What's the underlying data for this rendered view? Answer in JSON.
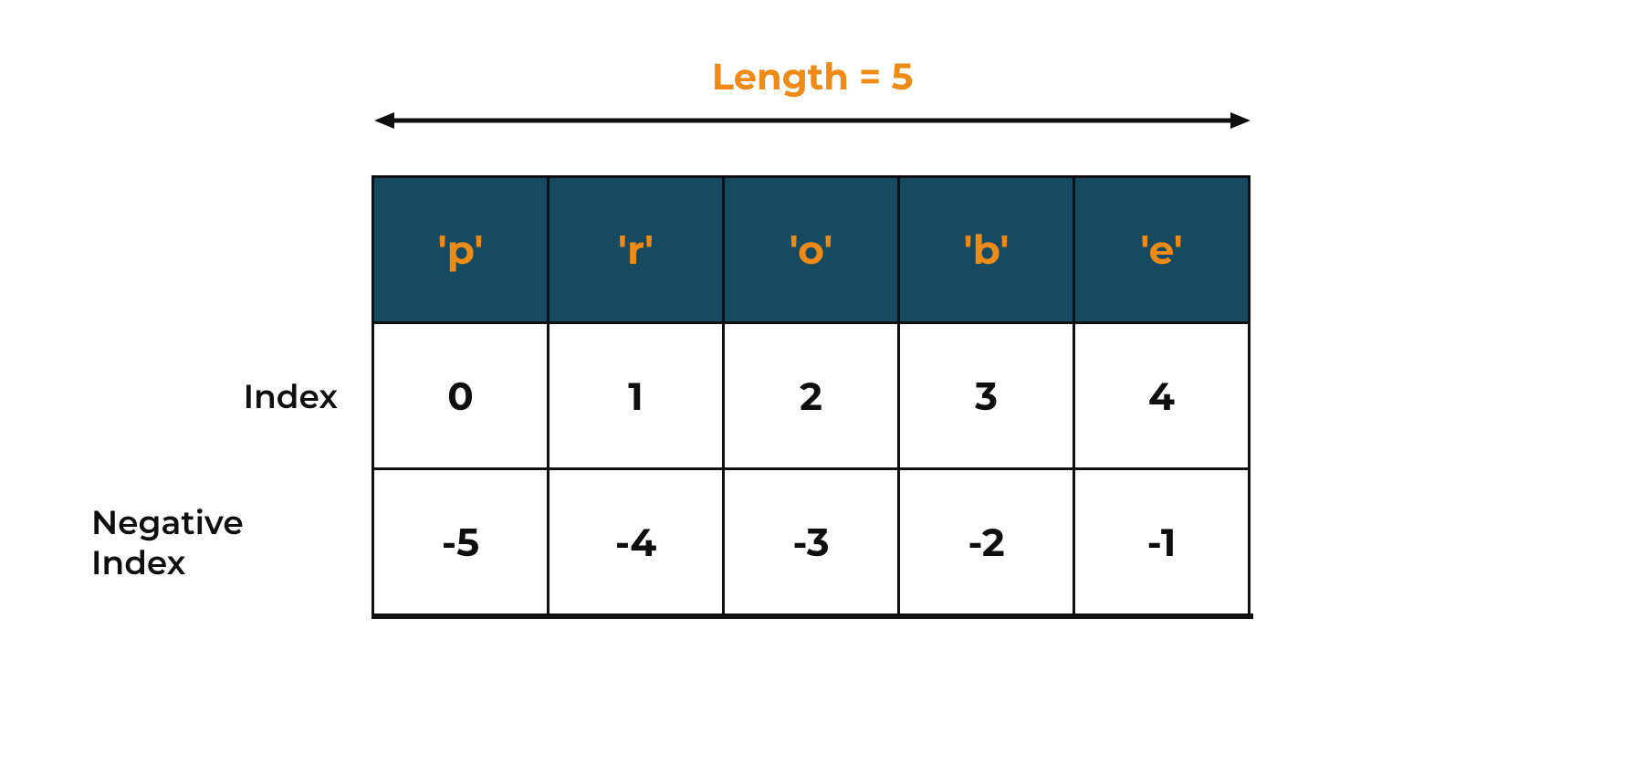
{
  "length_label": "Length = 5",
  "row_labels": {
    "chars": "",
    "index": "Index",
    "neg_index": "Negative Index"
  },
  "chars": [
    "'p'",
    "'r'",
    "'o'",
    "'b'",
    "'e'"
  ],
  "index": [
    "0",
    "1",
    "2",
    "3",
    "4"
  ],
  "neg_index": [
    "-5",
    "-4",
    "-3",
    "-2",
    "-1"
  ],
  "chart_data": {
    "type": "table",
    "title": "String indexing illustration",
    "length": 5,
    "characters": [
      "p",
      "r",
      "o",
      "b",
      "e"
    ],
    "positive_index": [
      0,
      1,
      2,
      3,
      4
    ],
    "negative_index": [
      -5,
      -4,
      -3,
      -2,
      -1
    ]
  }
}
